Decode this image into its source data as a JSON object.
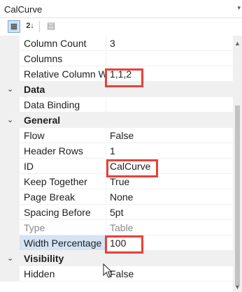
{
  "header": {
    "title": "CalCurve"
  },
  "toolbar": {
    "categorized_label": "▦",
    "alphabetical_label": "2↓",
    "pages_label": "▤"
  },
  "rows": [
    {
      "type": "prop",
      "name": "Column Count",
      "value": "3"
    },
    {
      "type": "prop",
      "name": "Columns",
      "value": ""
    },
    {
      "type": "prop",
      "name": "Relative Column W",
      "value": "1,1,2"
    },
    {
      "type": "cat",
      "toggle": "⌄",
      "name": "Data"
    },
    {
      "type": "prop",
      "name": "Data Binding",
      "value": ""
    },
    {
      "type": "cat",
      "toggle": "⌄",
      "name": "General"
    },
    {
      "type": "prop",
      "name": "Flow",
      "value": "False"
    },
    {
      "type": "prop",
      "name": "Header Rows",
      "value": "1"
    },
    {
      "type": "prop",
      "name": "ID",
      "value": "CalCurve"
    },
    {
      "type": "prop",
      "name": "Keep Together",
      "value": "True"
    },
    {
      "type": "prop",
      "name": "Page Break",
      "value": "None"
    },
    {
      "type": "prop",
      "name": "Spacing Before",
      "value": "5pt"
    },
    {
      "type": "prop",
      "name": "Type",
      "value": "Table"
    },
    {
      "type": "prop",
      "name": "Width Percentage",
      "value": "100"
    },
    {
      "type": "cat",
      "toggle": "⌄",
      "name": "Visibility"
    },
    {
      "type": "prop",
      "name": "Hidden",
      "value": "False"
    }
  ]
}
